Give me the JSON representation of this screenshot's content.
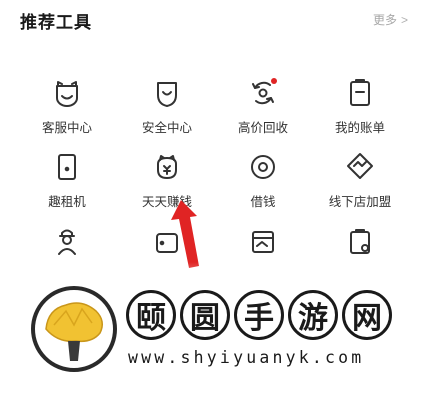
{
  "header": {
    "title": "推荐工具",
    "more_label": "更多",
    "more_icon": "chevron-right-icon"
  },
  "tools": [
    {
      "label": "客服中心",
      "icon": "bear-face-icon"
    },
    {
      "label": "安全中心",
      "icon": "shield-smile-icon"
    },
    {
      "label": "高价回收",
      "icon": "recycle-icon",
      "badge": true
    },
    {
      "label": "我的账单",
      "icon": "bill-icon"
    },
    {
      "label": "趣租机",
      "icon": "phone-rent-icon"
    },
    {
      "label": "天天赚钱",
      "icon": "money-bear-icon"
    },
    {
      "label": "借钱",
      "icon": "coin-icon"
    },
    {
      "label": "线下店加盟",
      "icon": "handshake-icon"
    }
  ],
  "colors": {
    "accent": "#e02424",
    "icon_stroke": "#333333",
    "muted": "#a8a8a8"
  },
  "watermark": {
    "chars": [
      "颐",
      "圆",
      "手",
      "游",
      "网"
    ],
    "url": "www.shyiyuanyk.com"
  }
}
